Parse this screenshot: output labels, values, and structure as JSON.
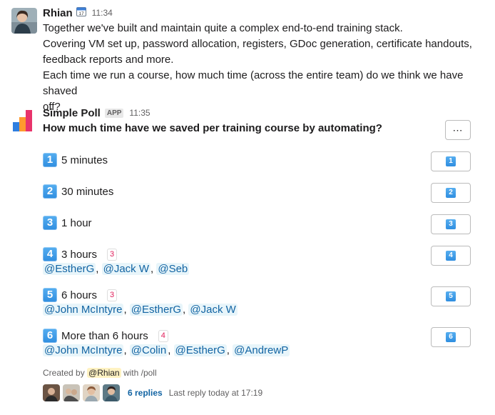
{
  "message1": {
    "author": "Rhian",
    "status_icon": "calendar-icon",
    "time": "11:34",
    "lines": [
      "Together we've built and maintain quite a complex end-to-end training stack.",
      "Covering VM set up, password allocation, registers, GDoc generation, certificate handouts,",
      "feedback reports and more.",
      "Each time we run a course, how much time (across the entire team) do we think we have shaved",
      "off?"
    ]
  },
  "message2": {
    "author": "Simple Poll",
    "badge": "APP",
    "time": "11:35",
    "question": "How much time have we saved per training course by automating?",
    "more_label": "⋯",
    "options": [
      {
        "key": "1",
        "label": "5 minutes",
        "count": "",
        "mentions": []
      },
      {
        "key": "2",
        "label": "30 minutes",
        "count": "",
        "mentions": []
      },
      {
        "key": "3",
        "label": "1 hour",
        "count": "",
        "mentions": []
      },
      {
        "key": "4",
        "label": "3 hours",
        "count": "3",
        "mentions": [
          "@EstherG",
          "@Jack W",
          "@Seb"
        ]
      },
      {
        "key": "5",
        "label": "6 hours",
        "count": "3",
        "mentions": [
          "@John McIntyre",
          "@EstherG",
          "@Jack W"
        ]
      },
      {
        "key": "6",
        "label": "More than 6 hours",
        "count": "4",
        "mentions": [
          "@John McIntyre",
          "@Colin",
          "@EstherG",
          "@AndrewP"
        ]
      }
    ],
    "created_prefix": "Created by",
    "created_by": "@Rhian",
    "created_suffix": "with /poll",
    "replies": "6 replies",
    "last_reply": "Last reply today at 17:19"
  },
  "colors": {
    "link": "#1264a3",
    "mention_bg": "#e8f5fa",
    "count_red": "#e01e5a",
    "keycap_blue": "#2f8ee0"
  }
}
